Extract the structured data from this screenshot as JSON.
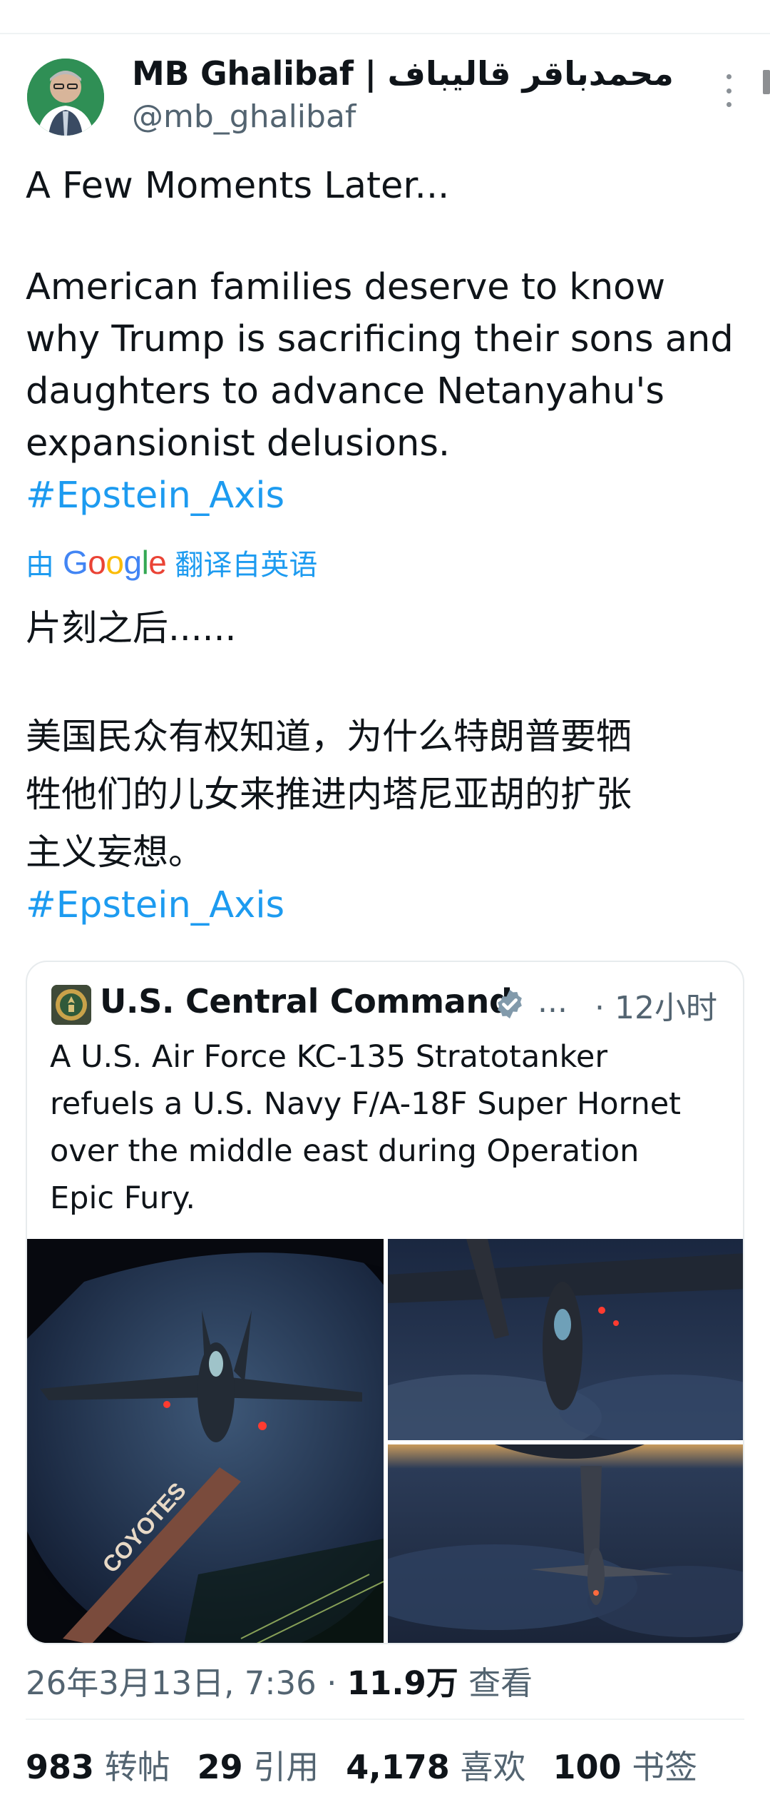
{
  "author": {
    "name": "MB Ghalibaf | محمدباقر قالیباف",
    "handle": "@mb_ghalibaf"
  },
  "tweet": {
    "line1": "A Few Moments Later...",
    "para_lines": [
      "American families deserve to know",
      "why Trump is sacrificing their sons and",
      "daughters to advance Netanyahu's",
      "expansionist delusions."
    ],
    "hashtag": "#Epstein_Axis"
  },
  "translation": {
    "prefix": "由",
    "brand": "Google",
    "suffix": "翻译自英语",
    "line1": "片刻之后......",
    "para_lines": [
      "美国民众有权知道，为什么特朗普要牺",
      "牲他们的儿女来推进内塔尼亚胡的扩张",
      "主义妄想。"
    ],
    "hashtag": "#Epstein_Axis"
  },
  "quote": {
    "name": "U.S. Central Command",
    "ellipsis": "...",
    "time": "· 12小时",
    "text_lines": [
      "A U.S. Air Force KC-135 Stratotanker",
      "refuels a U.S. Navy F/A-18F Super Hornet",
      "over the middle east during Operation",
      "Epic Fury."
    ],
    "media_text": "COYOTES"
  },
  "meta": {
    "date": "26年3月13日, 7:36",
    "dot": " · ",
    "views_count": "11.9万",
    "views_label": "查看"
  },
  "stats": [
    {
      "count": "983",
      "label": "转帖"
    },
    {
      "count": "29",
      "label": "引用"
    },
    {
      "count": "4,178",
      "label": "喜欢"
    },
    {
      "count": "100",
      "label": "书签"
    }
  ],
  "colors": {
    "link": "#1d9bf0",
    "secondary_text": "#536471",
    "primary_text": "#0f1419",
    "verified_badge": "#829aab"
  }
}
